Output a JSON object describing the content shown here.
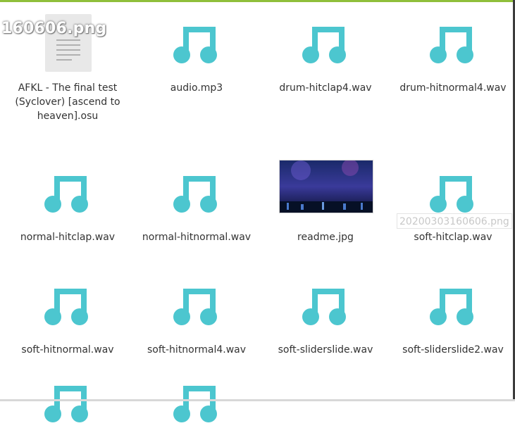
{
  "overlay": {
    "filename": "160606.png",
    "ghost_filename": "20200303160606.png"
  },
  "colors": {
    "accent_icon": "#4cc6cf",
    "top_bar": "#8fbf3a"
  },
  "files": [
    {
      "name": "AFKL - The final test (Syclover) [ascend to heaven].osu",
      "icon": "text-document-icon"
    },
    {
      "name": "audio.mp3",
      "icon": "music-note-icon"
    },
    {
      "name": "drum-hitclap4.wav",
      "icon": "music-note-icon"
    },
    {
      "name": "drum-hitnormal4.wav",
      "icon": "music-note-icon"
    },
    {
      "name": "normal-hitclap.wav",
      "icon": "music-note-icon"
    },
    {
      "name": "normal-hitnormal.wav",
      "icon": "music-note-icon"
    },
    {
      "name": "readme.jpg",
      "icon": "image-thumbnail"
    },
    {
      "name": "soft-hitclap.wav",
      "icon": "music-note-icon"
    },
    {
      "name": "soft-hitnormal.wav",
      "icon": "music-note-icon"
    },
    {
      "name": "soft-hitnormal4.wav",
      "icon": "music-note-icon"
    },
    {
      "name": "soft-sliderslide.wav",
      "icon": "music-note-icon"
    },
    {
      "name": "soft-sliderslide2.wav",
      "icon": "music-note-icon"
    },
    {
      "name": "",
      "icon": "music-note-icon"
    },
    {
      "name": "",
      "icon": "music-note-icon"
    }
  ]
}
